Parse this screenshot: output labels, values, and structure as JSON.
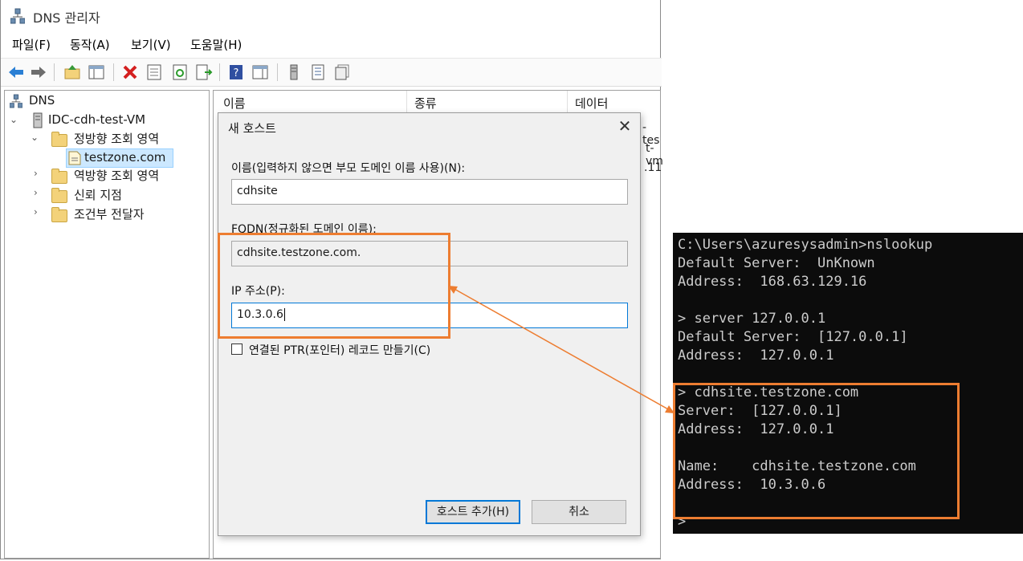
{
  "window": {
    "title": "DNS 관리자",
    "menu": [
      "파일(F)",
      "동작(A)",
      "보기(V)",
      "도움말(H)"
    ]
  },
  "toolbar": {
    "icons": [
      "back-icon",
      "forward-icon",
      "up-folder-icon",
      "show-hide-tree-icon",
      "delete-icon",
      "properties-icon",
      "refresh-icon",
      "export-list-icon",
      "help-icon",
      "show-pane-icon",
      "server-icon",
      "list-icon",
      "copy-icon"
    ]
  },
  "tree": {
    "root": "DNS",
    "server": "IDC-cdh-test-VM",
    "forward_zones": "정방향 조회 영역",
    "zone": "testzone.com",
    "reverse_zones": "역방향 조회 영역",
    "trust_points": "신뢰 지점",
    "conditional_forwarders": "조건부 전달자"
  },
  "list": {
    "columns": [
      "이름",
      "종류",
      "데이터"
    ],
    "peek": [
      "-tes",
      "t-vm",
      ".11"
    ]
  },
  "dialog": {
    "title": "새 호스트",
    "name_label": "이름(입력하지 않으면 부모 도메인 이름 사용)(N):",
    "name_value": "cdhsite",
    "fqdn_label": "FQDN(정규화된 도메인 이름):",
    "fqdn_value": "cdhsite.testzone.com.",
    "ip_label": "IP 주소(P):",
    "ip_value": "10.3.0.6",
    "ptr_label": "연결된 PTR(포인터) 레코드 만들기(C)",
    "add_button": "호스트 추가(H)",
    "cancel_button": "취소"
  },
  "console": {
    "lines": [
      "C:\\Users\\azuresysadmin>nslookup",
      "Default Server:  UnKnown",
      "Address:  168.63.129.16",
      "",
      "> server 127.0.0.1",
      "Default Server:  [127.0.0.1]",
      "Address:  127.0.0.1",
      "",
      "> cdhsite.testzone.com",
      "Server:  [127.0.0.1]",
      "Address:  127.0.0.1",
      "",
      "Name:    cdhsite.testzone.com",
      "Address:  10.3.0.6",
      "",
      "",
      ">"
    ]
  },
  "colors": {
    "highlight": "#ed7d31",
    "console_bg": "#0c0c0c",
    "console_fg": "#cccccc",
    "accent": "#0078d7"
  }
}
